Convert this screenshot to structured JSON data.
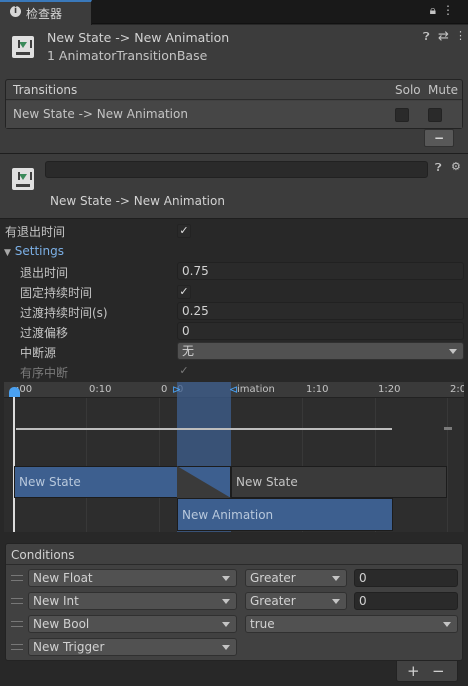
{
  "tab": {
    "title": "检查器"
  },
  "header": {
    "title": "New State -> New Animation",
    "subtitle": "1 AnimatorTransitionBase"
  },
  "transitions": {
    "header": "Transitions",
    "solo_label": "Solo",
    "mute_label": "Mute",
    "row": "New State -> New Animation",
    "remove_label": "−"
  },
  "transition_header": {
    "title": "New State -> New Animation",
    "name_value": ""
  },
  "settings": {
    "has_exit_time_label": "有退出时间",
    "has_exit_time": true,
    "foldout_label": "Settings",
    "exit_time_label": "退出时间",
    "exit_time": "0.75",
    "fixed_duration_label": "固定持续时间",
    "fixed_duration": true,
    "duration_label": "过渡持续时间(s)",
    "duration": "0.25",
    "offset_label": "过渡偏移",
    "offset": "0",
    "interruption_label": "中断源",
    "interruption_value": "无",
    "ordered_label": "有序中断",
    "ordered": true
  },
  "timeline": {
    "ticks": [
      ":00",
      "0:10",
      "0",
      "0",
      "1:10",
      "1:20",
      "2:0"
    ],
    "tick_partial": "imation",
    "state_a1": "New State",
    "state_a2": "New State",
    "state_b": "New Animation"
  },
  "conditions": {
    "header": "Conditions",
    "rows": [
      {
        "param": "New Float",
        "mode": "Greater",
        "value": "0"
      },
      {
        "param": "New Int",
        "mode": "Greater",
        "value": "0"
      },
      {
        "param": "New Bool",
        "mode": "true",
        "value": ""
      },
      {
        "param": "New Trigger",
        "mode": "",
        "value": ""
      }
    ],
    "add_label": "+",
    "remove_label": "−"
  },
  "colors": {
    "accent": "#3a79bb",
    "selection": "#3d5f8f",
    "panel": "#3c3c3c"
  },
  "icons": [
    "info-icon",
    "lock-icon",
    "menu-icon",
    "transition-icon",
    "help-icon",
    "preset-icon",
    "gear-icon"
  ]
}
